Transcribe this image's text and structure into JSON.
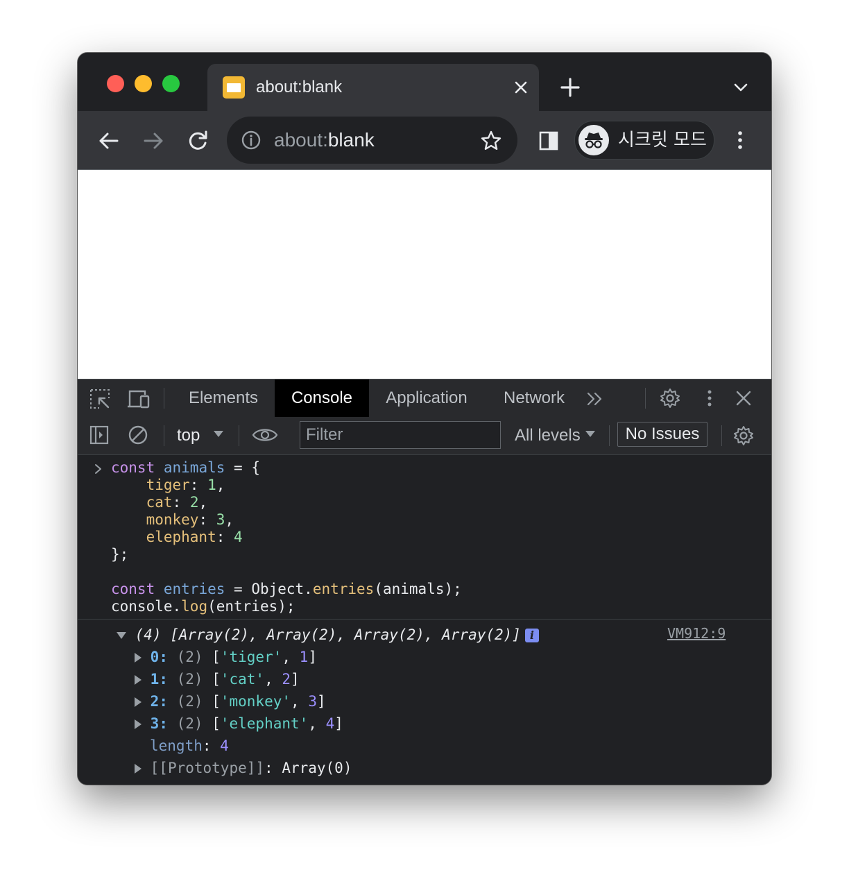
{
  "window": {
    "traffic_lights": {
      "close": "#ff5f57",
      "minimize": "#febc2e",
      "zoom": "#28c840"
    }
  },
  "tab": {
    "title": "about:blank",
    "close_icon": "close-icon",
    "new_tab_label": "+"
  },
  "toolbar": {
    "url_scheme": "about:",
    "url_rest": "blank",
    "incognito_label": "시크릿 모드"
  },
  "devtools": {
    "tabs": [
      {
        "label": "Elements",
        "active": false
      },
      {
        "label": "Console",
        "active": true
      },
      {
        "label": "Application",
        "active": false
      },
      {
        "label": "Network",
        "active": false
      }
    ],
    "more_tabs": "»",
    "context": "top",
    "filter_placeholder": "Filter",
    "levels": "All levels",
    "issues": "No Issues"
  },
  "console": {
    "input": {
      "line1_kw": "const",
      "line1_var": "animals",
      "line1_rest": " = {",
      "props": [
        {
          "key": "tiger",
          "value": "1",
          "suffix": ","
        },
        {
          "key": "cat",
          "value": "2",
          "suffix": ","
        },
        {
          "key": "monkey",
          "value": "3",
          "suffix": ","
        },
        {
          "key": "elephant",
          "value": "4",
          "suffix": ""
        }
      ],
      "close": "};",
      "line3_kw": "const",
      "line3_var": "entries",
      "line3_mid": " = Object.",
      "line3_fn": "entries",
      "line3_end": "(animals);",
      "line4_obj": "console.",
      "line4_fn": "log",
      "line4_end": "(entries);"
    },
    "output": {
      "summary": "(4) [Array(2), Array(2), Array(2), Array(2)]",
      "info_badge": "i",
      "source": "VM912:9",
      "items": [
        {
          "index": "0",
          "count": "(2)",
          "str": "'tiger'",
          "num": "1"
        },
        {
          "index": "1",
          "count": "(2)",
          "str": "'cat'",
          "num": "2"
        },
        {
          "index": "2",
          "count": "(2)",
          "str": "'monkey'",
          "num": "3"
        },
        {
          "index": "3",
          "count": "(2)",
          "str": "'elephant'",
          "num": "4"
        }
      ],
      "length_key": "length",
      "length_value": "4",
      "prototype_key": "[[Prototype]]",
      "prototype_value": "Array(0)"
    }
  }
}
